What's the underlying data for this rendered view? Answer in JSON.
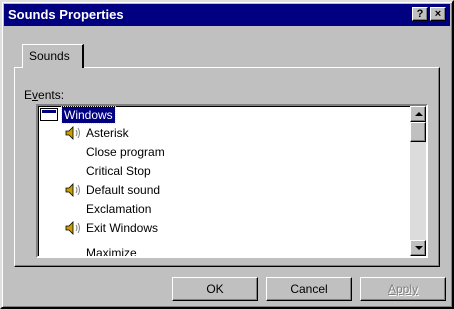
{
  "window": {
    "title": "Sounds Properties",
    "help_label": "?",
    "close_label": "×"
  },
  "tabs": [
    {
      "label": "Sounds"
    }
  ],
  "events_label": {
    "accel": "v",
    "pre": "E",
    "post": "ents:"
  },
  "events": [
    {
      "label": "Windows",
      "type": "root",
      "selected": true
    },
    {
      "label": "Asterisk",
      "icon": "speaker-icon"
    },
    {
      "label": "Close program"
    },
    {
      "label": "Critical Stop"
    },
    {
      "label": "Default sound",
      "icon": "speaker-icon"
    },
    {
      "label": "Exclamation"
    },
    {
      "label": "Exit Windows",
      "icon": "speaker-icon"
    },
    {
      "label": "Maximize"
    }
  ],
  "buttons": {
    "ok": "OK",
    "cancel": "Cancel",
    "apply": "Apply"
  },
  "colors": {
    "titlebar": "#000080",
    "face": "#c0c0c0",
    "selection": "#000080"
  }
}
